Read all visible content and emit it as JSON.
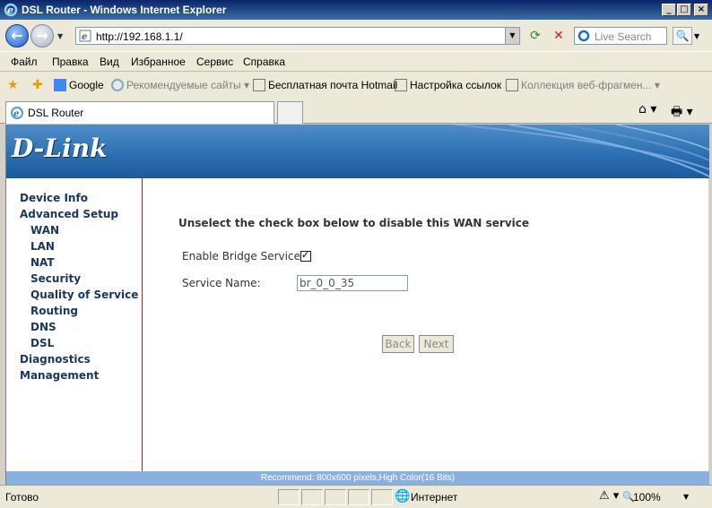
{
  "window": {
    "title": "DSL Router - Windows Internet Explorer"
  },
  "address": {
    "url": "http://192.168.1.1/"
  },
  "search": {
    "placeholder": "Live Search"
  },
  "menu": [
    "Файл",
    "Правка",
    "Вид",
    "Избранное",
    "Сервис",
    "Справка"
  ],
  "favorites": {
    "google": "Google",
    "recommended": "Рекомендуемые сайты ▾",
    "hotmail": "Бесплатная почта Hotmail",
    "links": "Настройка ссылок",
    "gallery": "Коллекция веб-фрагмен... ▾"
  },
  "tab": {
    "label": "DSL Router"
  },
  "brand": {
    "logo": "D-Link"
  },
  "sidebar": {
    "items": [
      "Device Info",
      "Advanced Setup",
      "WAN",
      "LAN",
      "NAT",
      "Security",
      "Quality of Service",
      "Routing",
      "DNS",
      "DSL",
      "Diagnostics",
      "Management"
    ]
  },
  "main": {
    "heading": "Unselect the check box below to disable this WAN service",
    "bridge_label": "Enable Bridge Service:",
    "bridge_checked": true,
    "service_name_label": "Service Name:",
    "service_name_value": "br_0_0_35",
    "back_label": "Back",
    "next_label": "Next"
  },
  "recommend": "Recommend: 800x600 pixels,High Color(16 Bits)",
  "status": {
    "text": "Готово",
    "zone": "Интернет",
    "zoom": "100%"
  }
}
